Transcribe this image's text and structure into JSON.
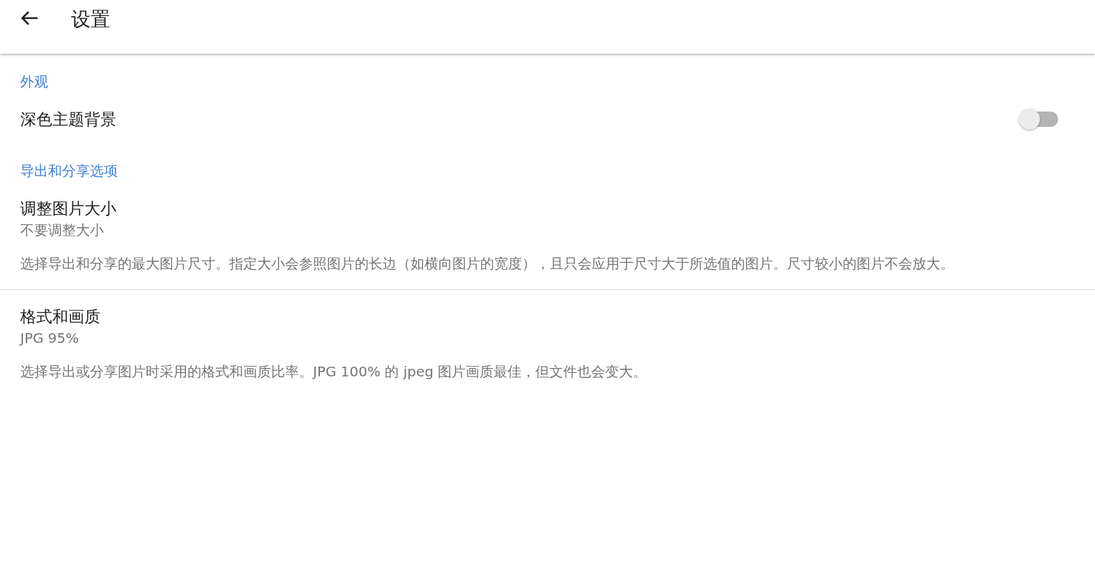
{
  "header": {
    "title": "设置"
  },
  "sections": [
    {
      "title": "外观",
      "items": [
        {
          "kind": "switch",
          "title": "深色主题背景",
          "on": false
        }
      ]
    },
    {
      "title": "导出和分享选项",
      "items": [
        {
          "kind": "pref",
          "title": "调整图片大小",
          "value": "不要调整大小",
          "description": "选择导出和分享的最大图片尺寸。指定大小会参照图片的长边（如横向图片的宽度），且只会应用于尺寸大于所选值的图片。尺寸较小的图片不会放大。"
        },
        {
          "kind": "pref",
          "title": "格式和画质",
          "value": "JPG 95%",
          "description": "选择导出或分享图片时采用的格式和画质比率。JPG 100% 的 jpeg 图片画质最佳，但文件也会变大。"
        }
      ]
    }
  ]
}
